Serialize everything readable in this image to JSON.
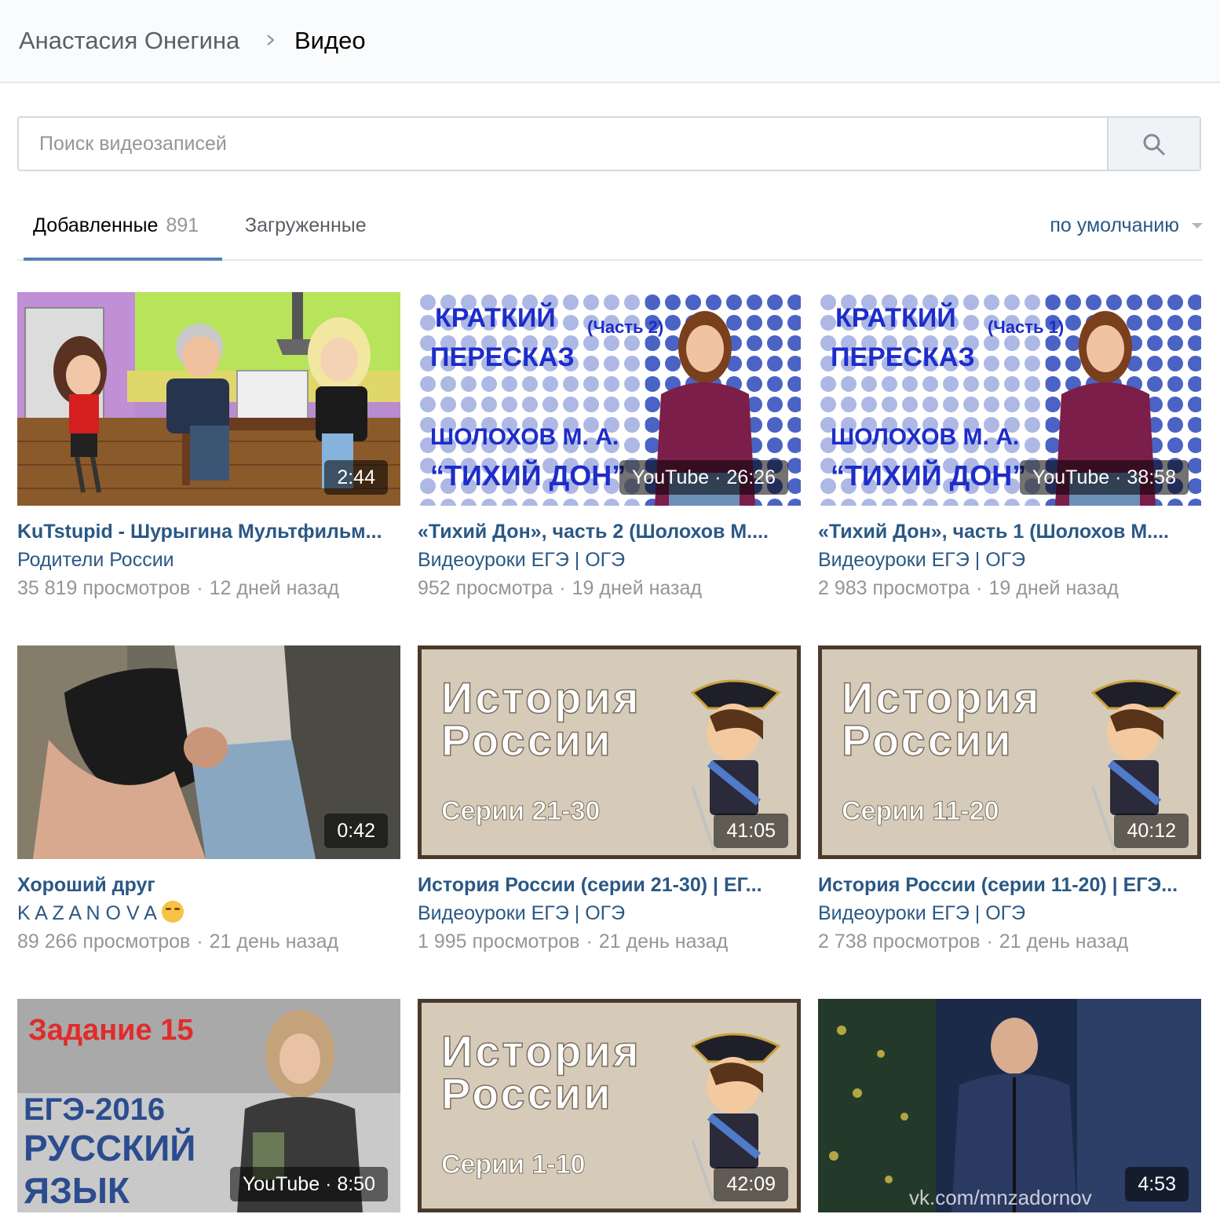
{
  "header": {
    "parent": "Анастасия Онегина",
    "current": "Видео"
  },
  "search": {
    "placeholder": "Поиск видеозаписей",
    "value": ""
  },
  "tabs": {
    "added_label": "Добавленные",
    "added_count": "891",
    "uploaded_label": "Загруженные",
    "sort_label": "по умолчанию"
  },
  "videos": [
    {
      "title": "KuTstupid - Шурыгина Мультфильм...",
      "author": "Родители России",
      "views": "35 819 просмотров",
      "date": "12 дней назад",
      "duration": "2:44"
    },
    {
      "title": "«Тихий Дон», часть 2 (Шолохов М....",
      "author": "Видеоуроки ЕГЭ | ОГЭ",
      "views": "952 просмотра",
      "date": "19 дней назад",
      "duration": "YouTube · 26:26",
      "thumb": {
        "line1": "КРАТКИЙ",
        "part": "(Часть 2)",
        "line2": "ПЕРЕСКАЗ",
        "line3": "ШОЛОХОВ М. А.",
        "line4": "“ТИХИЙ ДОН”"
      }
    },
    {
      "title": "«Тихий Дон», часть 1 (Шолохов М....",
      "author": "Видеоуроки ЕГЭ | ОГЭ",
      "views": "2 983 просмотра",
      "date": "19 дней назад",
      "duration": "YouTube · 38:58",
      "thumb": {
        "line1": "КРАТКИЙ",
        "part": "(Часть 1)",
        "line2": "ПЕРЕСКАЗ",
        "line3": "ШОЛОХОВ М. А.",
        "line4": "“ТИХИЙ ДОН”"
      }
    },
    {
      "title": "Хороший друг",
      "author": "K A Z A N O V A",
      "views": "89 266 просмотров",
      "date": "21 день назад",
      "duration": "0:42"
    },
    {
      "title": "История России (серии 21-30) | ЕГ...",
      "author": "Видеоуроки ЕГЭ | ОГЭ",
      "views": "1 995 просмотров",
      "date": "21 день назад",
      "duration": "41:05",
      "thumb": {
        "line1": "История",
        "line2": "России",
        "series": "Серии 21-30"
      }
    },
    {
      "title": "История России (серии 11-20) | ЕГЭ...",
      "author": "Видеоуроки ЕГЭ | ОГЭ",
      "views": "2 738 просмотров",
      "date": "21 день назад",
      "duration": "40:12",
      "thumb": {
        "line1": "История",
        "line2": "России",
        "series": "Серии 11-20"
      }
    },
    {
      "title": "",
      "author": "",
      "views": "",
      "date": "",
      "duration": "YouTube · 8:50",
      "thumb": {
        "task": "Задание 15",
        "line1": "ЕГЭ-2016",
        "line2": "РУССКИЙ",
        "line3": "ЯЗЫК"
      }
    },
    {
      "title": "",
      "author": "",
      "views": "",
      "date": "",
      "duration": "42:09",
      "thumb": {
        "line1": "История",
        "line2": "России",
        "series": "Серии 1-10"
      }
    },
    {
      "title": "",
      "author": "",
      "views": "",
      "date": "",
      "duration": "4:53",
      "thumb": {
        "watermark": "vk.com/mnzadornov"
      }
    }
  ],
  "colors": {
    "link": "#2a5885",
    "muted": "#939699",
    "tab_accent": "#5181b8",
    "thumb_text_blue": "#1d2dc9",
    "parchment": "#d6cbb9"
  },
  "icons": {
    "search": "search-icon",
    "breadcrumb_separator": "chevron-right-icon",
    "sort": "caret-down-icon"
  }
}
